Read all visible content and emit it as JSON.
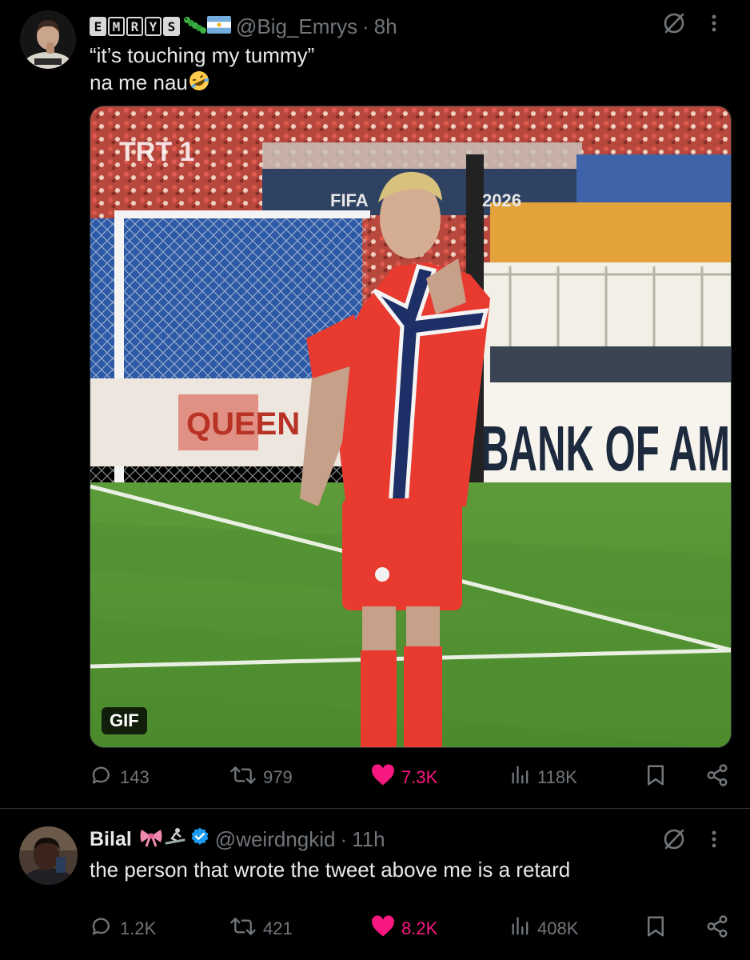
{
  "post1": {
    "author": {
      "name_letters": [
        "E",
        "M",
        "R",
        "Y",
        "S"
      ],
      "handle": "@Big_Emrys",
      "dot": "·",
      "time": "8h",
      "flag": "argentina-flag-icon"
    },
    "text_line1": "“it’s touching my tummy”",
    "text_line2": "na me nau",
    "text_emoji": "rofl-emoji-icon",
    "media": {
      "badge": "GIF",
      "broadcaster": "TRT 1",
      "banner_left": "FIFA",
      "banner_right": "2026",
      "board": "BANK OF AM",
      "board_left": "QUEEN"
    },
    "stats": {
      "replies": "143",
      "reposts": "979",
      "likes": "7.3K",
      "views": "118K",
      "liked": true
    }
  },
  "post2": {
    "author": {
      "name": "Bilal",
      "handle": "@weirdngkid",
      "dot": "·",
      "time": "11h",
      "verified": true
    },
    "text": "the person that wrote the tweet above me is a retard",
    "stats": {
      "replies": "1.2K",
      "reposts": "421",
      "likes": "8.2K",
      "views": "408K",
      "liked": true
    }
  },
  "colors": {
    "background": "#000000",
    "text": "#e7e9ea",
    "muted": "#71767b",
    "like": "#f91880",
    "verified": "#1d9bf0"
  }
}
